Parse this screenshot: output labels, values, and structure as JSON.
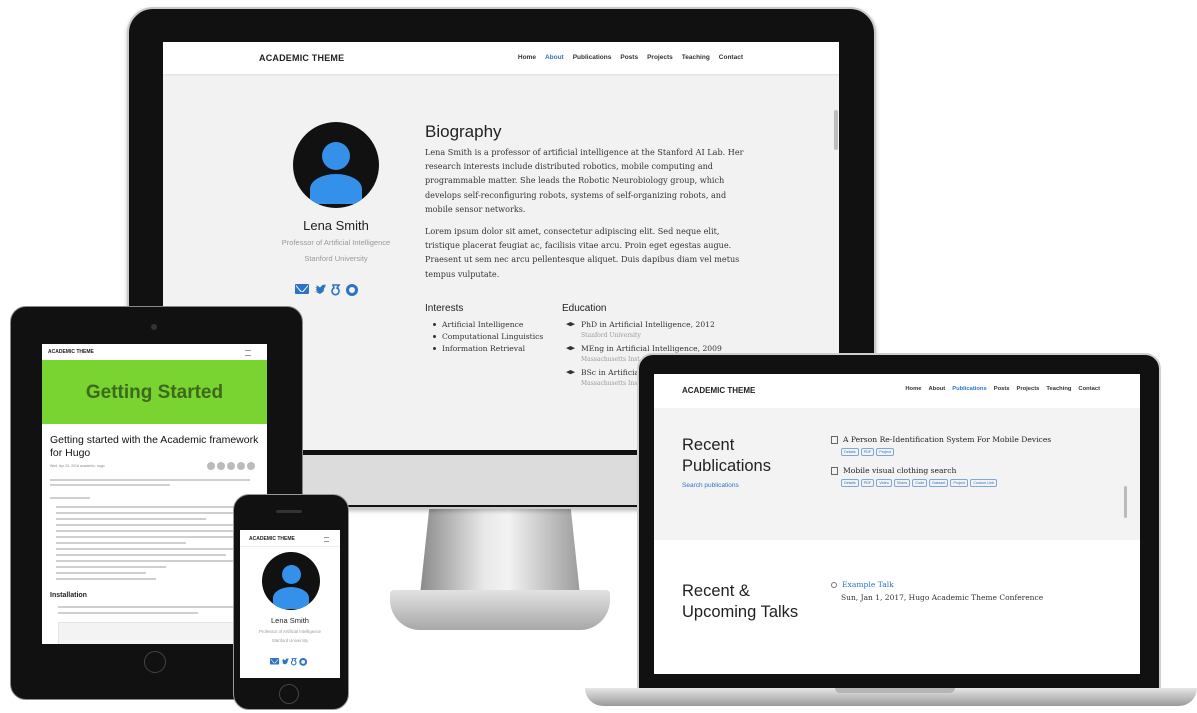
{
  "monitor": {
    "brand": "ACADEMIC THEME",
    "nav": [
      {
        "label": "Home",
        "active": false
      },
      {
        "label": "About",
        "active": true
      },
      {
        "label": "Publications",
        "active": false
      },
      {
        "label": "Posts",
        "active": false
      },
      {
        "label": "Projects",
        "active": false
      },
      {
        "label": "Teaching",
        "active": false
      },
      {
        "label": "Contact",
        "active": false
      }
    ],
    "profile": {
      "name": "Lena Smith",
      "role": "Professor of Artificial Intelligence",
      "organization": "Stanford University",
      "social_icons": [
        "envelope-icon",
        "twitter-icon",
        "google-scholar-icon",
        "github-icon"
      ]
    },
    "biography": {
      "title": "Biography",
      "paragraph1": "Lena Smith is a professor of artificial intelligence at the Stanford AI Lab. Her research interests include distributed robotics, mobile computing and programmable matter. She leads the Robotic Neurobiology group, which develops self-reconfiguring robots, systems of self-organizing robots, and mobile sensor networks.",
      "paragraph2": "Lorem ipsum dolor sit amet, consectetur adipiscing elit. Sed neque elit, tristique placerat feugiat ac, facilisis vitae arcu. Proin eget egestas augue. Praesent ut sem nec arcu pellentesque aliquet. Duis dapibus diam vel metus tempus vulputate."
    },
    "interests": {
      "title": "Interests",
      "items": [
        "Artificial Intelligence",
        "Computational Linguistics",
        "Information Retrieval"
      ]
    },
    "education": {
      "title": "Education",
      "items": [
        {
          "degree": "PhD in Artificial Intelligence, 2012",
          "school": "Stanford University"
        },
        {
          "degree": "MEng in Artificial Intelligence, 2009",
          "school": "Massachusetts Inst"
        },
        {
          "degree": "BSc in Artificial",
          "school": "Massachusetts Ins"
        }
      ]
    }
  },
  "tablet": {
    "brand": "ACADEMIC THEME",
    "hero": "Getting Started",
    "post_title": "Getting started with the Academic framework for Hugo",
    "meta": "Wed, Apr 20, 2016   academic, hugo",
    "installation_heading": "Installation"
  },
  "phone": {
    "brand": "ACADEMIC THEME",
    "name": "Lena Smith",
    "role": "Professor of Artificial Intelligence",
    "organization": "Stanford University"
  },
  "laptop": {
    "brand": "ACADEMIC THEME",
    "nav": [
      {
        "label": "Home",
        "active": false
      },
      {
        "label": "About",
        "active": false
      },
      {
        "label": "Publications",
        "active": true
      },
      {
        "label": "Posts",
        "active": false
      },
      {
        "label": "Projects",
        "active": false
      },
      {
        "label": "Teaching",
        "active": false
      },
      {
        "label": "Contact",
        "active": false
      }
    ],
    "publications": {
      "title_line1": "Recent",
      "title_line2": "Publications",
      "search_link": "Search publications",
      "items": [
        {
          "title": "A Person Re-Identification System For Mobile Devices",
          "tags": [
            "Details",
            "PDF",
            "Project"
          ]
        },
        {
          "title": "Mobile visual clothing search",
          "tags": [
            "Details",
            "PDF",
            "Video",
            "Slides",
            "Code",
            "Dataset",
            "Project",
            "Custom Link"
          ]
        }
      ]
    },
    "talks": {
      "title_line1": "Recent &",
      "title_line2": "Upcoming Talks",
      "item_title": "Example Talk",
      "item_meta": "Sun, Jan 1, 2017, Hugo Academic Theme Conference"
    }
  },
  "colors": {
    "accent": "#2e74c5",
    "hero_green": "#79d330",
    "avatar_blue": "#3490e8"
  }
}
